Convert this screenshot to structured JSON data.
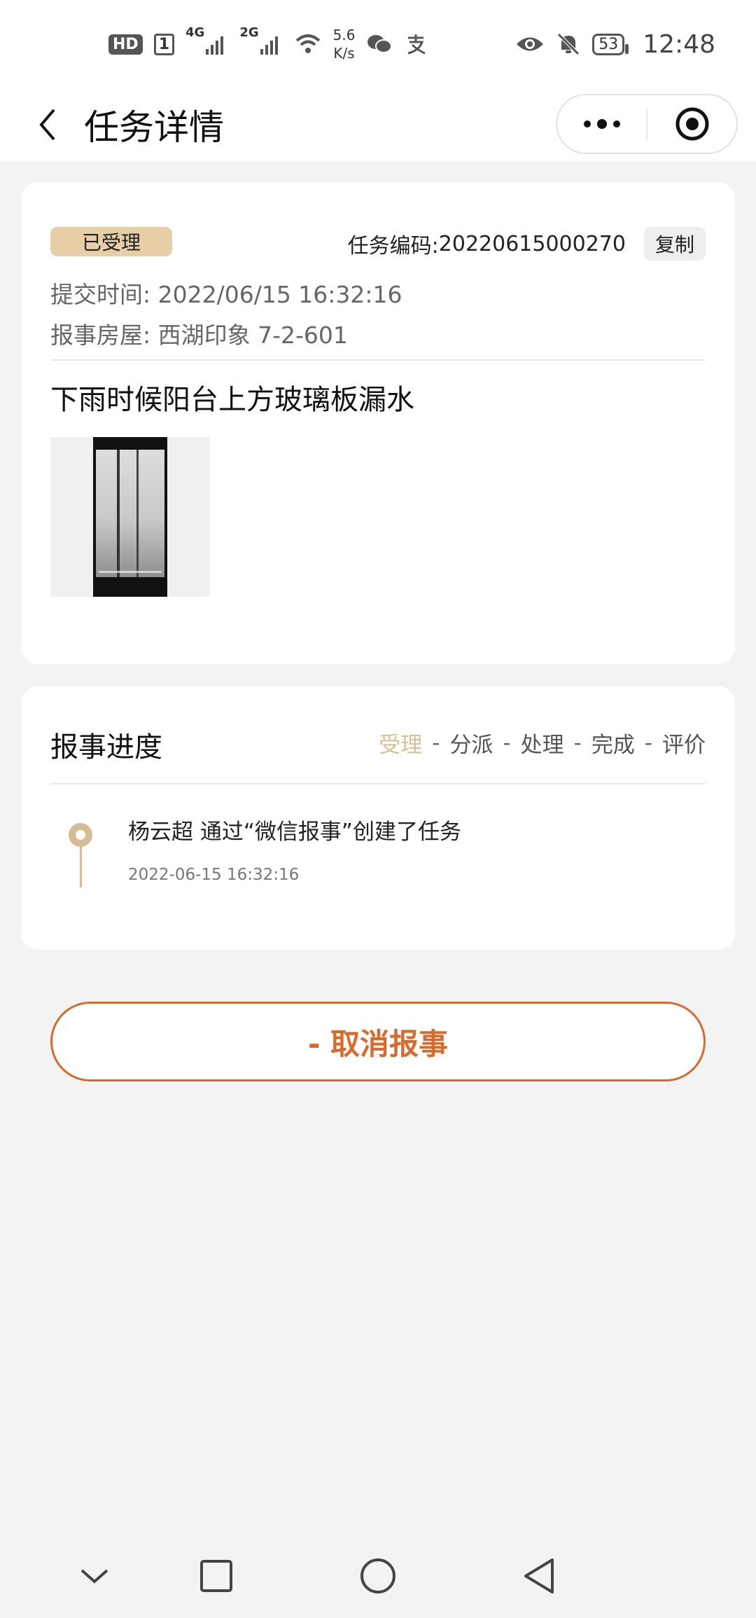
{
  "status_bar": {
    "hd": "HD",
    "sim": "1",
    "net1": "4G",
    "net2": "2G",
    "speed_value": "5.6",
    "speed_unit": "K/s",
    "battery": "53",
    "time": "12:48",
    "icons": [
      "wifi-icon",
      "wechat-icon",
      "alipay-icon",
      "eye-icon",
      "mute-icon"
    ]
  },
  "nav": {
    "title": "任务详情",
    "back_icon": "chevron-left-icon",
    "more_icon": "more-dots-icon",
    "close_icon": "target-icon"
  },
  "task": {
    "status": "已受理",
    "code_label": "任务编码:",
    "code": "20220615000270",
    "copy_label": "复制",
    "submit_time": "提交时间: 2022/06/15 16:32:16",
    "house": "报事房屋: 西湖印象 7-2-601",
    "description": "下雨时候阳台上方玻璃板漏水"
  },
  "progress": {
    "title": "报事进度",
    "steps": [
      "受理",
      "分派",
      "处理",
      "完成",
      "评价"
    ],
    "separator": "-",
    "active_step_color": "#d9bf97",
    "timeline": [
      {
        "text": "杨云超 通过“微信报事”创建了任务",
        "time": "2022-06-15 16:32:16"
      }
    ]
  },
  "actions": {
    "cancel_label": "- 取消报事",
    "accent_color": "#d96a2b"
  },
  "system_nav": [
    "chevron-down-icon",
    "square-icon",
    "circle-icon",
    "triangle-back-icon"
  ]
}
